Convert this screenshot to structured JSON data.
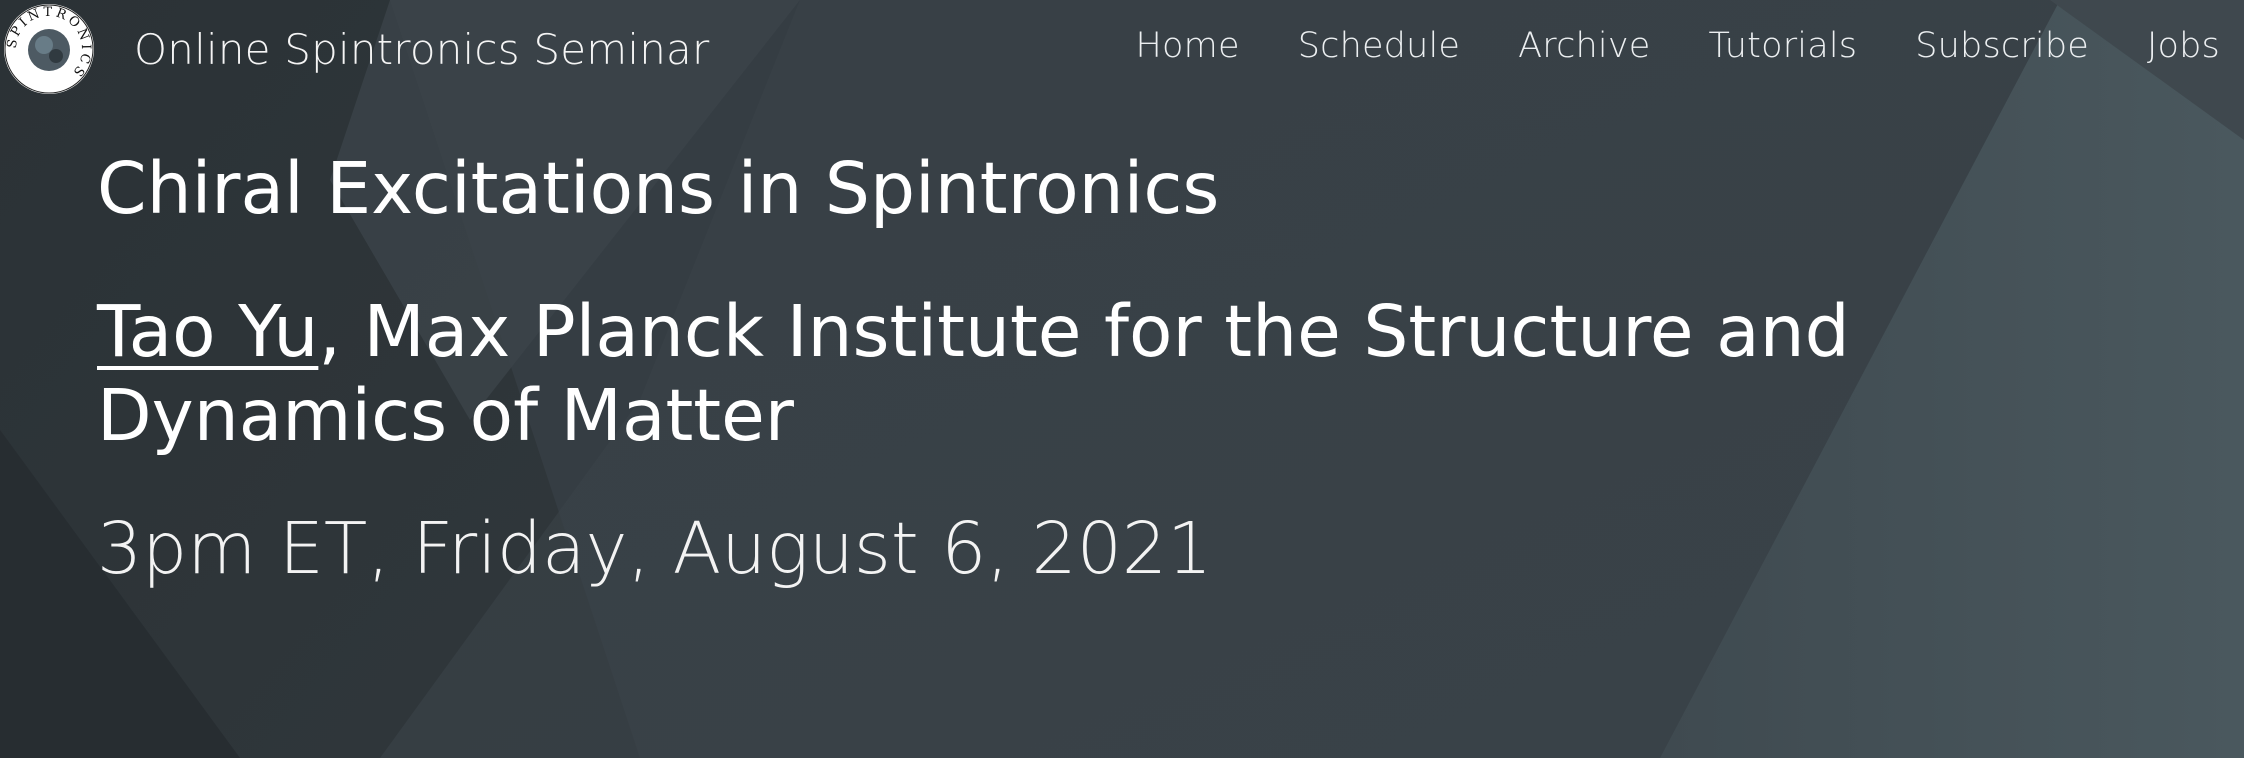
{
  "site": {
    "name": "Online Spintronics Seminar",
    "logo_text": "SPINTRONICS"
  },
  "nav": {
    "items": [
      {
        "label": "Home"
      },
      {
        "label": "Schedule"
      },
      {
        "label": "Archive"
      },
      {
        "label": "Tutorials"
      },
      {
        "label": "Subscribe"
      },
      {
        "label": "Jobs"
      }
    ]
  },
  "talk": {
    "title": "Chiral Excitations in Spintronics",
    "speaker_name": "Tao Yu",
    "affiliation": ", Max Planck Institute for the Structure and Dynamics of Matter",
    "datetime": "3pm ET, Friday, August 6, 2021"
  },
  "theme": {
    "background": "#343c42",
    "text": "#ffffff"
  }
}
